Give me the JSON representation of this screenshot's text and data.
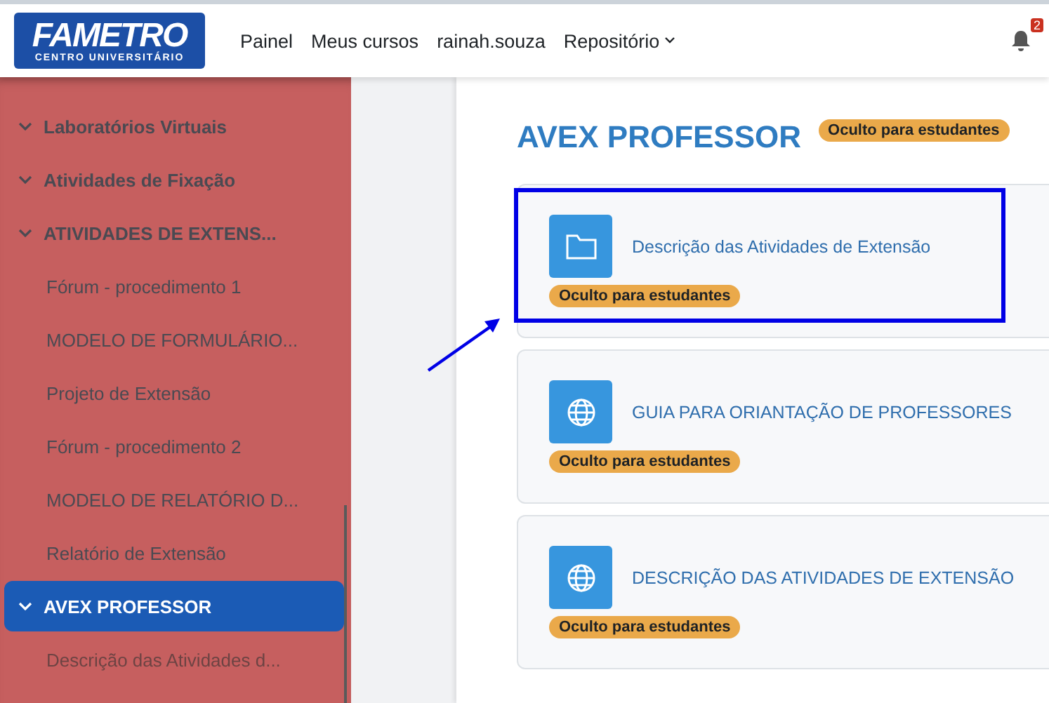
{
  "navbar": {
    "logo": {
      "name": "FAMETRO",
      "subtitle": "CENTRO UNIVERSITÁRIO"
    },
    "links": [
      {
        "label": "Painel",
        "dropdown": false
      },
      {
        "label": "Meus cursos",
        "dropdown": false
      },
      {
        "label": "rainah.souza",
        "dropdown": false
      },
      {
        "label": "Repositório",
        "dropdown": true
      }
    ],
    "notifications": {
      "count": "2"
    }
  },
  "sidebar": {
    "items": [
      {
        "kind": "section",
        "label": "Laboratórios Virtuais",
        "selected": false,
        "dimmed": false
      },
      {
        "kind": "section",
        "label": "Atividades de Fixação",
        "selected": false,
        "dimmed": false
      },
      {
        "kind": "section",
        "label": "ATIVIDADES DE EXTENS...",
        "selected": false,
        "dimmed": false
      },
      {
        "kind": "activity",
        "label": "Fórum - procedimento 1",
        "selected": false,
        "dimmed": false
      },
      {
        "kind": "activity",
        "label": "MODELO DE FORMULÁRIO...",
        "selected": false,
        "dimmed": false
      },
      {
        "kind": "activity",
        "label": "Projeto de Extensão",
        "selected": false,
        "dimmed": false
      },
      {
        "kind": "activity",
        "label": "Fórum - procedimento 2",
        "selected": false,
        "dimmed": false
      },
      {
        "kind": "activity",
        "label": "MODELO DE RELATÓRIO D...",
        "selected": false,
        "dimmed": false
      },
      {
        "kind": "activity",
        "label": "Relatório de Extensão",
        "selected": false,
        "dimmed": false
      },
      {
        "kind": "section",
        "label": "AVEX PROFESSOR",
        "selected": true,
        "dimmed": false
      },
      {
        "kind": "activity",
        "label": "Descrição das Atividades d...",
        "selected": false,
        "dimmed": true
      }
    ]
  },
  "main": {
    "title": "AVEX PROFESSOR",
    "title_badge": "Oculto para estudantes",
    "activities": [
      {
        "kind": "folder",
        "label": "Descrição das Atividades de Extensão",
        "badge": "Oculto para estudantes",
        "highlighted": true
      },
      {
        "kind": "url",
        "label": "GUIA PARA ORIANTAÇÃO DE PROFESSORES",
        "badge": "Oculto para estudantes",
        "highlighted": false
      },
      {
        "kind": "url",
        "label": "DESCRIÇÃO DAS ATIVIDADES DE EXTENSÃO",
        "badge": "Oculto para estudantes",
        "highlighted": false
      }
    ]
  }
}
